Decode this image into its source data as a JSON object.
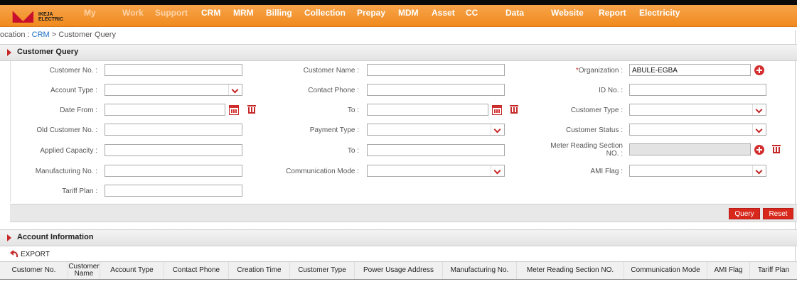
{
  "app": {
    "logo_line1": "IKEJA",
    "logo_line2": "ELECTRIC"
  },
  "nav": {
    "items": [
      "My",
      "Work",
      "Support",
      "CRM",
      "MRM",
      "Billing",
      "Collection",
      "Prepay",
      "MDM",
      "Asset",
      "CC",
      "Data",
      "Website",
      "Report",
      "Electricity"
    ]
  },
  "breadcrumb": {
    "prefix": "ocation : ",
    "link": "CRM",
    "separator": " > ",
    "current": "Customer Query"
  },
  "customer_query": {
    "title": "Customer Query",
    "labels": {
      "customer_no": "Customer No. :",
      "customer_name": "Customer Name :",
      "organization": "Organization :",
      "account_type": "Account Type :",
      "contact_phone": "Contact Phone :",
      "id_no": "ID No. :",
      "date_from": "Date From :",
      "to": "To :",
      "customer_type": "Customer Type :",
      "old_customer_no": "Old Customer No. :",
      "payment_type": "Payment Type :",
      "customer_status": "Customer Status :",
      "applied_capacity": "Applied Capacity :",
      "to2": "To :",
      "meter_reading_section": "Meter Reading Section NO. :",
      "manufacturing_no": "Manufacturing No. :",
      "communication_mode": "Communication Mode :",
      "ami_flag": "AMI Flag :",
      "tariff_plan": "Tariff Plan :"
    },
    "required_mark": "*",
    "values": {
      "organization": "ABULE-EGBA"
    }
  },
  "buttons": {
    "query": "Query",
    "reset": "Reset"
  },
  "account_information": {
    "title": "Account Information",
    "export_label": "EXPORT",
    "columns": [
      "Customer No.",
      "Customer Name",
      "Account Type",
      "Contact Phone",
      "Creation Time",
      "Customer Type",
      "Power Usage Address",
      "Manufacturing No.",
      "Meter Reading Section NO.",
      "Communication Mode",
      "AMI Flag",
      "Tariff Plan"
    ]
  },
  "colors": {
    "nav_orange": "#f08a1e",
    "accent_red": "#d7281b"
  }
}
